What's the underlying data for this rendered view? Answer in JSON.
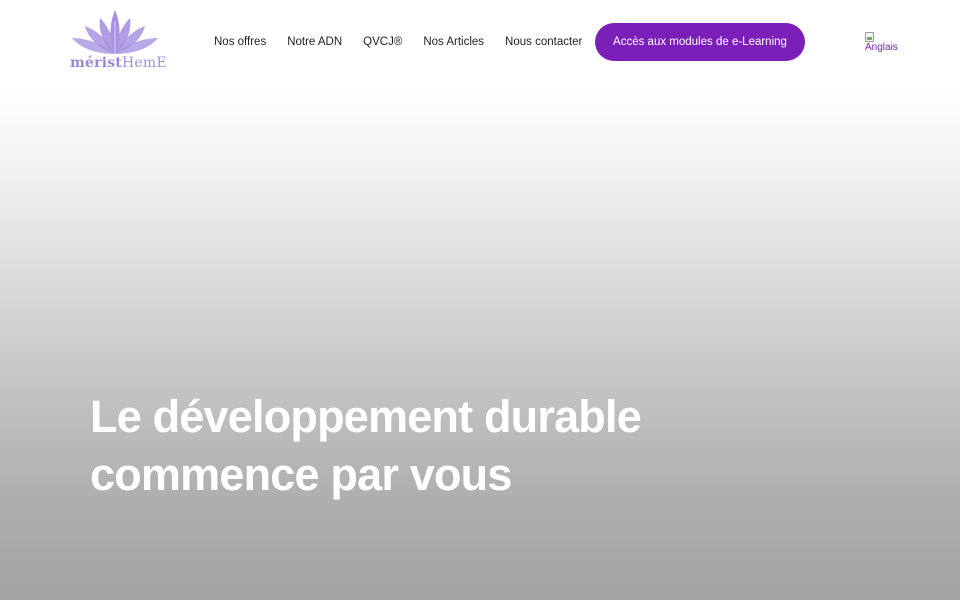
{
  "brand": {
    "logo_text_bold": "mérist",
    "logo_text_light": "HemE",
    "logo_icon": "lotus-icon",
    "colors": {
      "logo": "#a48de0",
      "accent": "#7c1fb8"
    }
  },
  "nav": {
    "items": [
      {
        "label": "Nos offres"
      },
      {
        "label": "Notre ADN"
      },
      {
        "label": "QVCJ®"
      },
      {
        "label": "Nos Articles"
      },
      {
        "label": "Nous contacter"
      }
    ]
  },
  "cta": {
    "label": "Accès aux modules de e-Learning"
  },
  "language": {
    "alt": "Anglais",
    "icon": "broken-image-icon"
  },
  "hero": {
    "line1": "Le développement durable",
    "line2": "commence par vous"
  }
}
